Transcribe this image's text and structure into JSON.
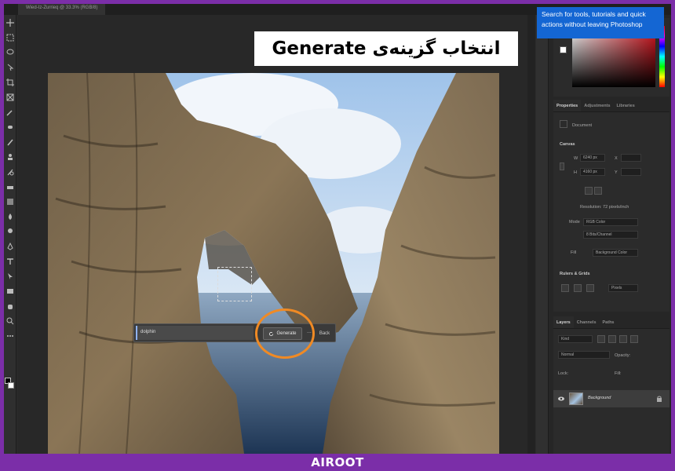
{
  "document_tab": "Wied-Iz-Zurrieq @ 33.3% (RGB/8)",
  "overlay_title": "انتخاب گزینه‌ی Generate",
  "tooltip": "Search for tools, tutorials and quick actions without leaving Photoshop",
  "generate_bar": {
    "prompt_value": "dolphin",
    "generate_label": "Generate",
    "more_label": "...",
    "back_label": "Back"
  },
  "properties": {
    "tabs": [
      "Properties",
      "Adjustments",
      "Libraries"
    ],
    "document_label": "Document",
    "canvas_section": "Canvas",
    "w_label": "W",
    "w_value": "6240 px",
    "h_label": "H",
    "h_value": "4160 px",
    "x_label": "X",
    "y_label": "Y",
    "resolution": "Resolution: 72 pixels/inch",
    "mode_label": "Mode",
    "mode_value": "RGB Color",
    "bit_value": "8 Bits/Channel",
    "fill_label": "Fill",
    "fill_value": "Background Color",
    "rulers_section": "Rulers & Grids",
    "units_value": "Pixels"
  },
  "layers": {
    "tabs": [
      "Layers",
      "Channels",
      "Paths"
    ],
    "kind_label": "Kind",
    "blend_mode": "Normal",
    "opacity_label": "Opacity:",
    "lock_label": "Lock:",
    "fill_label": "Fill:",
    "layer_name": "Background"
  },
  "footer_brand": "AIROOT",
  "colors": {
    "frame": "#7b2ea8",
    "highlight": "#f08a24",
    "tooltip": "#1466d3"
  }
}
